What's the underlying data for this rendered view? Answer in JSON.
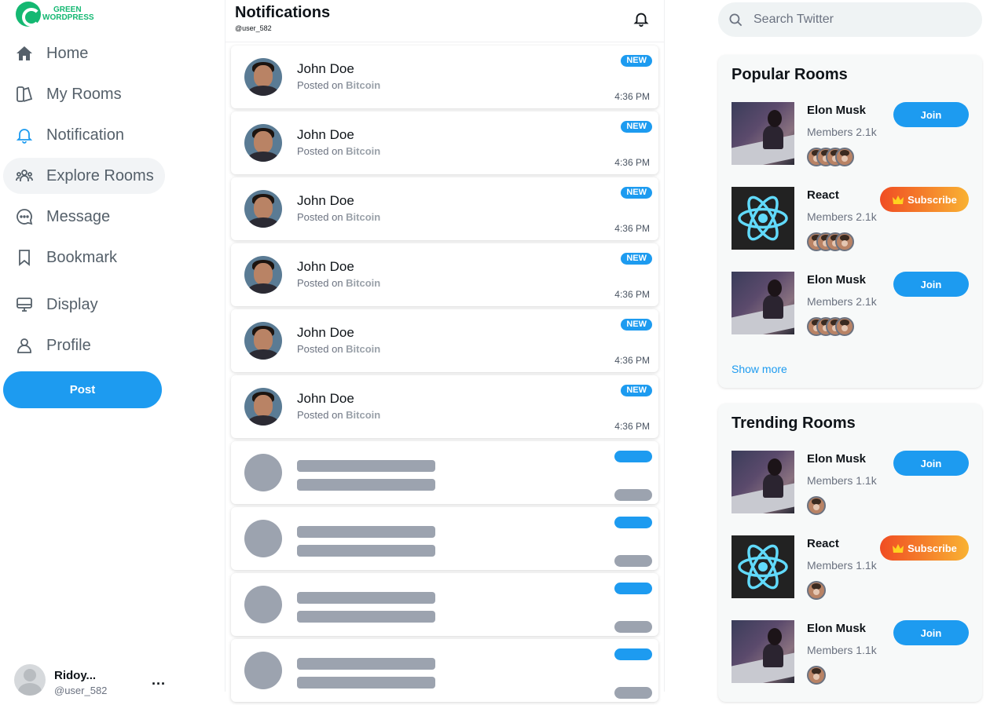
{
  "sidebar": {
    "logo": {
      "line1": "GREEN",
      "line2": "WORDPRESS"
    },
    "items": [
      {
        "label": "Home",
        "icon": "home-icon"
      },
      {
        "label": "My Rooms",
        "icon": "rooms-icon"
      },
      {
        "label": "Notification",
        "icon": "bell-icon"
      },
      {
        "label": "Explore Rooms",
        "icon": "people-icon"
      },
      {
        "label": "Message",
        "icon": "message-icon"
      },
      {
        "label": "Bookmark",
        "icon": "bookmark-icon"
      },
      {
        "label": "Display",
        "icon": "monitor-icon"
      },
      {
        "label": "Profile",
        "icon": "user-icon"
      }
    ],
    "post_label": "Post",
    "user": {
      "name": "Ridoy...",
      "handle": "@user_582",
      "more": "..."
    }
  },
  "main": {
    "title": "Notifications",
    "handle": "@user_582",
    "notifications": [
      {
        "name": "John Doe",
        "posted_prefix": "Posted on",
        "topic": "Bitcoin",
        "badge": "NEW",
        "time": "4:36 PM"
      },
      {
        "name": "John Doe",
        "posted_prefix": "Posted on",
        "topic": "Bitcoin",
        "badge": "NEW",
        "time": "4:36 PM"
      },
      {
        "name": "John Doe",
        "posted_prefix": "Posted on",
        "topic": "Bitcoin",
        "badge": "NEW",
        "time": "4:36 PM"
      },
      {
        "name": "John Doe",
        "posted_prefix": "Posted on",
        "topic": "Bitcoin",
        "badge": "NEW",
        "time": "4:36 PM"
      },
      {
        "name": "John Doe",
        "posted_prefix": "Posted on",
        "topic": "Bitcoin",
        "badge": "NEW",
        "time": "4:36 PM"
      },
      {
        "name": "John Doe",
        "posted_prefix": "Posted on",
        "topic": "Bitcoin",
        "badge": "NEW",
        "time": "4:36 PM"
      }
    ],
    "loading_placeholder_count": 4
  },
  "right": {
    "search_placeholder": "Search Twitter",
    "popular": {
      "title": "Popular Rooms",
      "rooms": [
        {
          "name": "Elon Musk",
          "members": "Members 2.1k",
          "action": "Join"
        },
        {
          "name": "React",
          "members": "Members 2.1k",
          "action": "Subscribe"
        },
        {
          "name": "Elon Musk",
          "members": "Members 2.1k",
          "action": "Join"
        }
      ],
      "show_more": "Show more"
    },
    "trending": {
      "title": "Trending Rooms",
      "rooms": [
        {
          "name": "Elon Musk",
          "members": "Members 1.1k",
          "action": "Join"
        },
        {
          "name": "React",
          "members": "Members 1.1k",
          "action": "Subscribe"
        },
        {
          "name": "Elon Musk",
          "members": "Members 1.1k",
          "action": "Join"
        }
      ]
    }
  },
  "colors": {
    "accent": "#1d9bf0",
    "brand": "#14b872",
    "skeleton": "#9ca3af",
    "subscribe_from": "#f04d23",
    "subscribe_to": "#f9b233"
  }
}
